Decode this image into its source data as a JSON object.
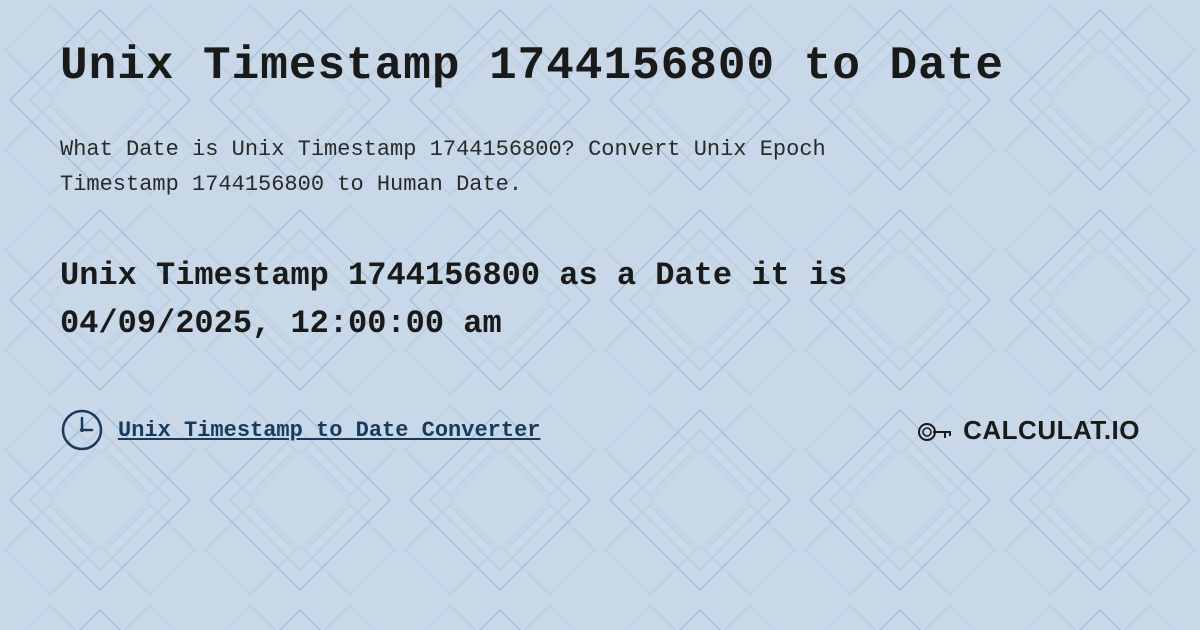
{
  "page": {
    "title": "Unix Timestamp 1744156800 to Date",
    "description_line1": "What Date is Unix Timestamp 1744156800? Convert Unix Epoch",
    "description_line2": "Timestamp 1744156800 to Human Date.",
    "result_line1": "Unix Timestamp 1744156800 as a Date it is",
    "result_line2": "04/09/2025, 12:00:00 am",
    "footer_link": "Unix Timestamp to Date Converter",
    "logo_text": "CALCULAT.IO",
    "background_color": "#c8d8e8",
    "accent_color": "#1a3a5c"
  }
}
